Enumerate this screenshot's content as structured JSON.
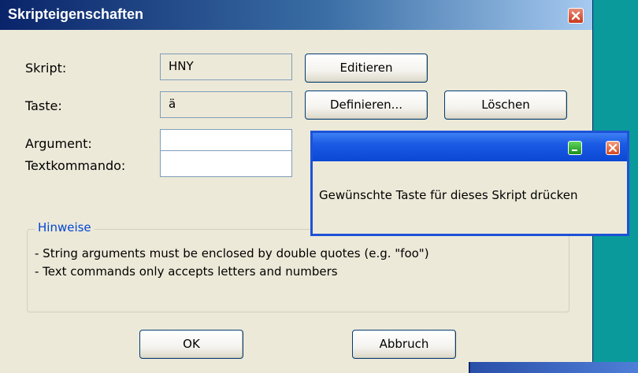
{
  "dialog": {
    "title": "Skripteigenschaften",
    "fields": {
      "script_label": "Skript:",
      "script_value": "HNY",
      "key_label": "Taste:",
      "key_value": "ä",
      "argument_label": "Argument:",
      "argument_value": "",
      "textcmd_label": "Textkommando:",
      "textcmd_value": ""
    },
    "buttons": {
      "edit": "Editieren",
      "define": "Definieren...",
      "delete": "Löschen",
      "ok": "OK",
      "cancel": "Abbruch"
    },
    "hints": {
      "legend": "Hinweise",
      "lines": [
        "- String arguments must be enclosed by double quotes (e.g. \"foo\")",
        "- Text commands only accepts letters and numbers"
      ]
    }
  },
  "popup": {
    "message": "Gewünschte Taste für dieses Skript drücken"
  },
  "colors": {
    "desktop": "#0a9a9c",
    "dialog_bg": "#ece9d8",
    "title_start": "#0a246a",
    "hint_legend": "#0046d5",
    "popup_title": "#1a5ae4"
  },
  "icons": {
    "dialog_close": "close-icon",
    "popup_minimize": "minimize-icon",
    "popup_close": "close-icon"
  }
}
